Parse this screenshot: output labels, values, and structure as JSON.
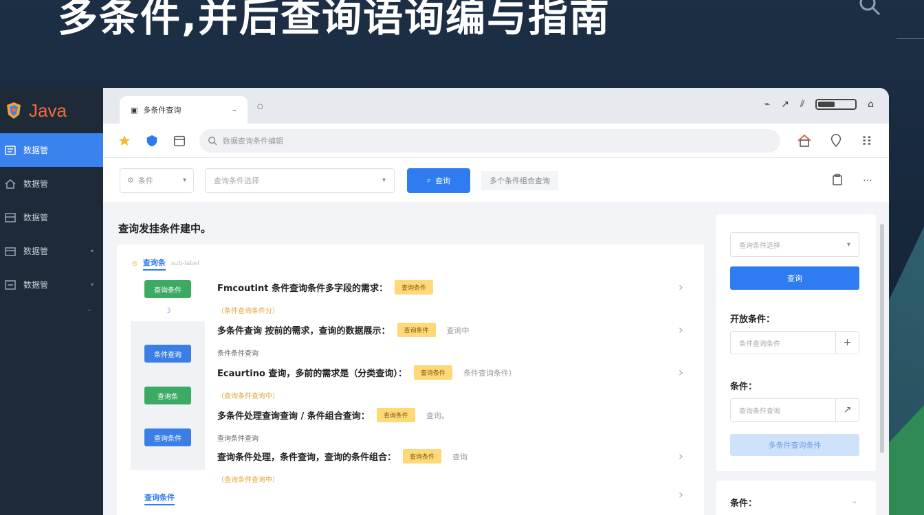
{
  "headline": "多条件,并后查询语询编与指南",
  "sidebar": {
    "brand": "Java",
    "items": [
      {
        "label": "数据管",
        "icon": "list-icon",
        "active": true
      },
      {
        "label": "数据管",
        "icon": "home-icon",
        "active": false
      },
      {
        "label": "数据管",
        "icon": "table-icon",
        "active": false
      },
      {
        "label": "数据管",
        "icon": "folder-icon",
        "active": false,
        "caret": "▾"
      },
      {
        "label": "数据管",
        "icon": "form-icon",
        "active": false,
        "caret": "▾"
      }
    ],
    "more": "⌄"
  },
  "browser": {
    "tab_title": "多条件查询",
    "tab_close": "–",
    "tab_new": "○",
    "url_placeholder": "数据查询条件编辑"
  },
  "toolbar": {
    "select_small": "条件",
    "select_large": "查询条件选择",
    "primary_button": "查询",
    "ghost_button": "多个条件组合查询"
  },
  "main": {
    "title": "查询发挂条件建中。",
    "section1": {
      "label": "查询条",
      "sub": "sub-label"
    },
    "section2": {
      "label": "查询条件"
    },
    "rows": [
      {
        "question": "Fmcoutint 条件查询条件多字段的需求：",
        "badge": "查询条件",
        "extra": "",
        "sub": "（条件查询条件分）",
        "sub_style": "orange"
      },
      {
        "question": "多条件查询 按前的需求，查询的数据展示：",
        "badge": "查询条件",
        "extra": "查询中",
        "sub": "条件条件查询",
        "sub_style": "gray"
      },
      {
        "question": "Ecaurtino 查询，多前的需求是（分类查询）：",
        "badge": "查询条件",
        "extra": "条件查询条件）",
        "sub": "（查询条件查询中）",
        "sub_style": "orange"
      },
      {
        "question": "多条件处理查询查询 / 条件组合查询：",
        "badge": "查询条件",
        "extra": "查询。",
        "sub": "查询条件查询",
        "sub_style": "gray"
      },
      {
        "question": "查询条件处理，条件查询，查询的条件组合：",
        "badge": "查询条件",
        "extra": "查询",
        "sub": "（查询条件查询中）",
        "sub_style": "orange"
      }
    ],
    "tag_buttons": [
      "查询条件",
      "条件查询",
      "查询条",
      "查询条件"
    ]
  },
  "right_panel": {
    "select": "查询条件选择",
    "button": "查询",
    "label1": "开放条件：",
    "input1": "条件查询条件",
    "input1_btn": "+",
    "label2": "条件：",
    "input2": "查询条件查询",
    "input2_btn": "↗",
    "light_button": "多条件查询条件",
    "label3": "条件：",
    "label3_caret": "⌄"
  },
  "colors": {
    "accent": "#2e7cf0",
    "badge": "#ffd978",
    "sidebar": "#1f2a38",
    "brand": "#f26a3d",
    "green": "#3daa63"
  }
}
